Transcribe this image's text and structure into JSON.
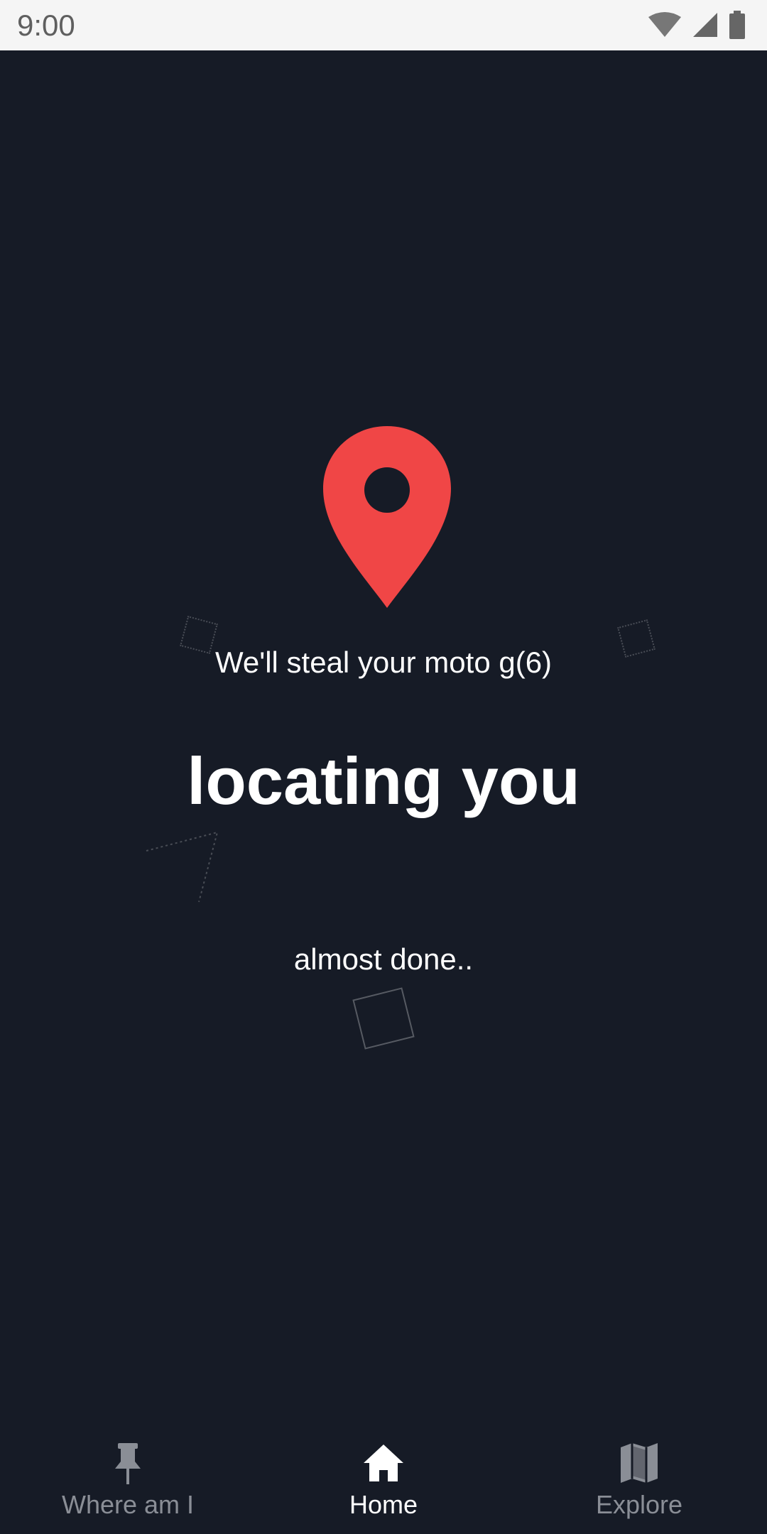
{
  "status_bar": {
    "time": "9:00",
    "icons": [
      "wifi-icon",
      "cell-signal-icon",
      "battery-icon"
    ]
  },
  "main": {
    "subtitle": "We'll steal your moto g(6)",
    "headline": "locating you",
    "status_message": "almost done..",
    "pin_icon": "location-pin-icon"
  },
  "bottom_nav": {
    "items": [
      {
        "label": "Where am I",
        "icon": "pushpin-icon",
        "active": false
      },
      {
        "label": "Home",
        "icon": "home-icon",
        "active": true
      },
      {
        "label": "Explore",
        "icon": "map-icon",
        "active": false
      }
    ]
  },
  "colors": {
    "background": "#161b26",
    "accent": "#f04646",
    "active_nav": "#ffffff",
    "inactive_nav": "#8a8e96",
    "status_bar_bg": "#f5f5f5"
  }
}
